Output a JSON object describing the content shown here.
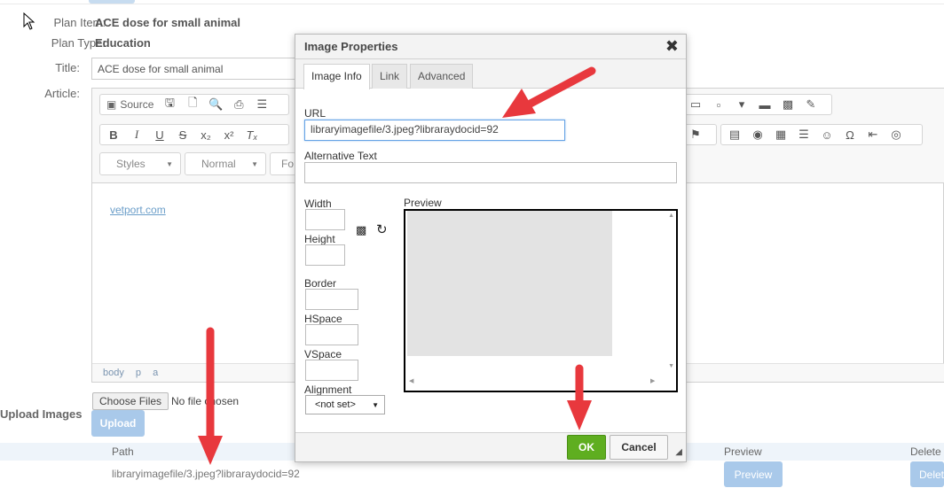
{
  "form": {
    "plan_item_label": "Plan Item:",
    "plan_item_value": "ACE dose for small animal",
    "plan_type_label": "Plan Type:",
    "plan_type_value": "Education",
    "title_label": "Title:",
    "title_value": "ACE dose for small animal",
    "article_label": "Article:"
  },
  "editor": {
    "source_label": "Source",
    "styles_label": "Styles",
    "format_label": "Normal",
    "font_label": "Fo",
    "content_link": "vetport.com",
    "path": [
      "body",
      "p",
      "a"
    ]
  },
  "upload": {
    "label": "Upload Images",
    "choose_files": "Choose Files",
    "no_file": "No file chosen",
    "upload_button": "Upload"
  },
  "table": {
    "headers": {
      "path": "Path",
      "preview": "Preview",
      "delete": "Delete"
    },
    "rows": [
      {
        "path": "libraryimagefile/3.jpeg?libraraydocid=92",
        "preview_button": "Preview",
        "delete_button": "Delete"
      }
    ]
  },
  "dialog": {
    "title": "Image Properties",
    "close_icon": "close-icon",
    "tabs": [
      "Image Info",
      "Link",
      "Advanced"
    ],
    "url_label": "URL",
    "url_value": "libraryimagefile/3.jpeg?libraraydocid=92",
    "alt_label": "Alternative Text",
    "width_label": "Width",
    "height_label": "Height",
    "border_label": "Border",
    "hspace_label": "HSpace",
    "vspace_label": "VSpace",
    "alignment_label": "Alignment",
    "alignment_value": "<not set>",
    "preview_label": "Preview",
    "ok_label": "OK",
    "cancel_label": "Cancel"
  },
  "colors": {
    "annotation_arrow": "#e8383d",
    "ok_button": "#5fae20",
    "upload_button": "#a9c9ea"
  }
}
